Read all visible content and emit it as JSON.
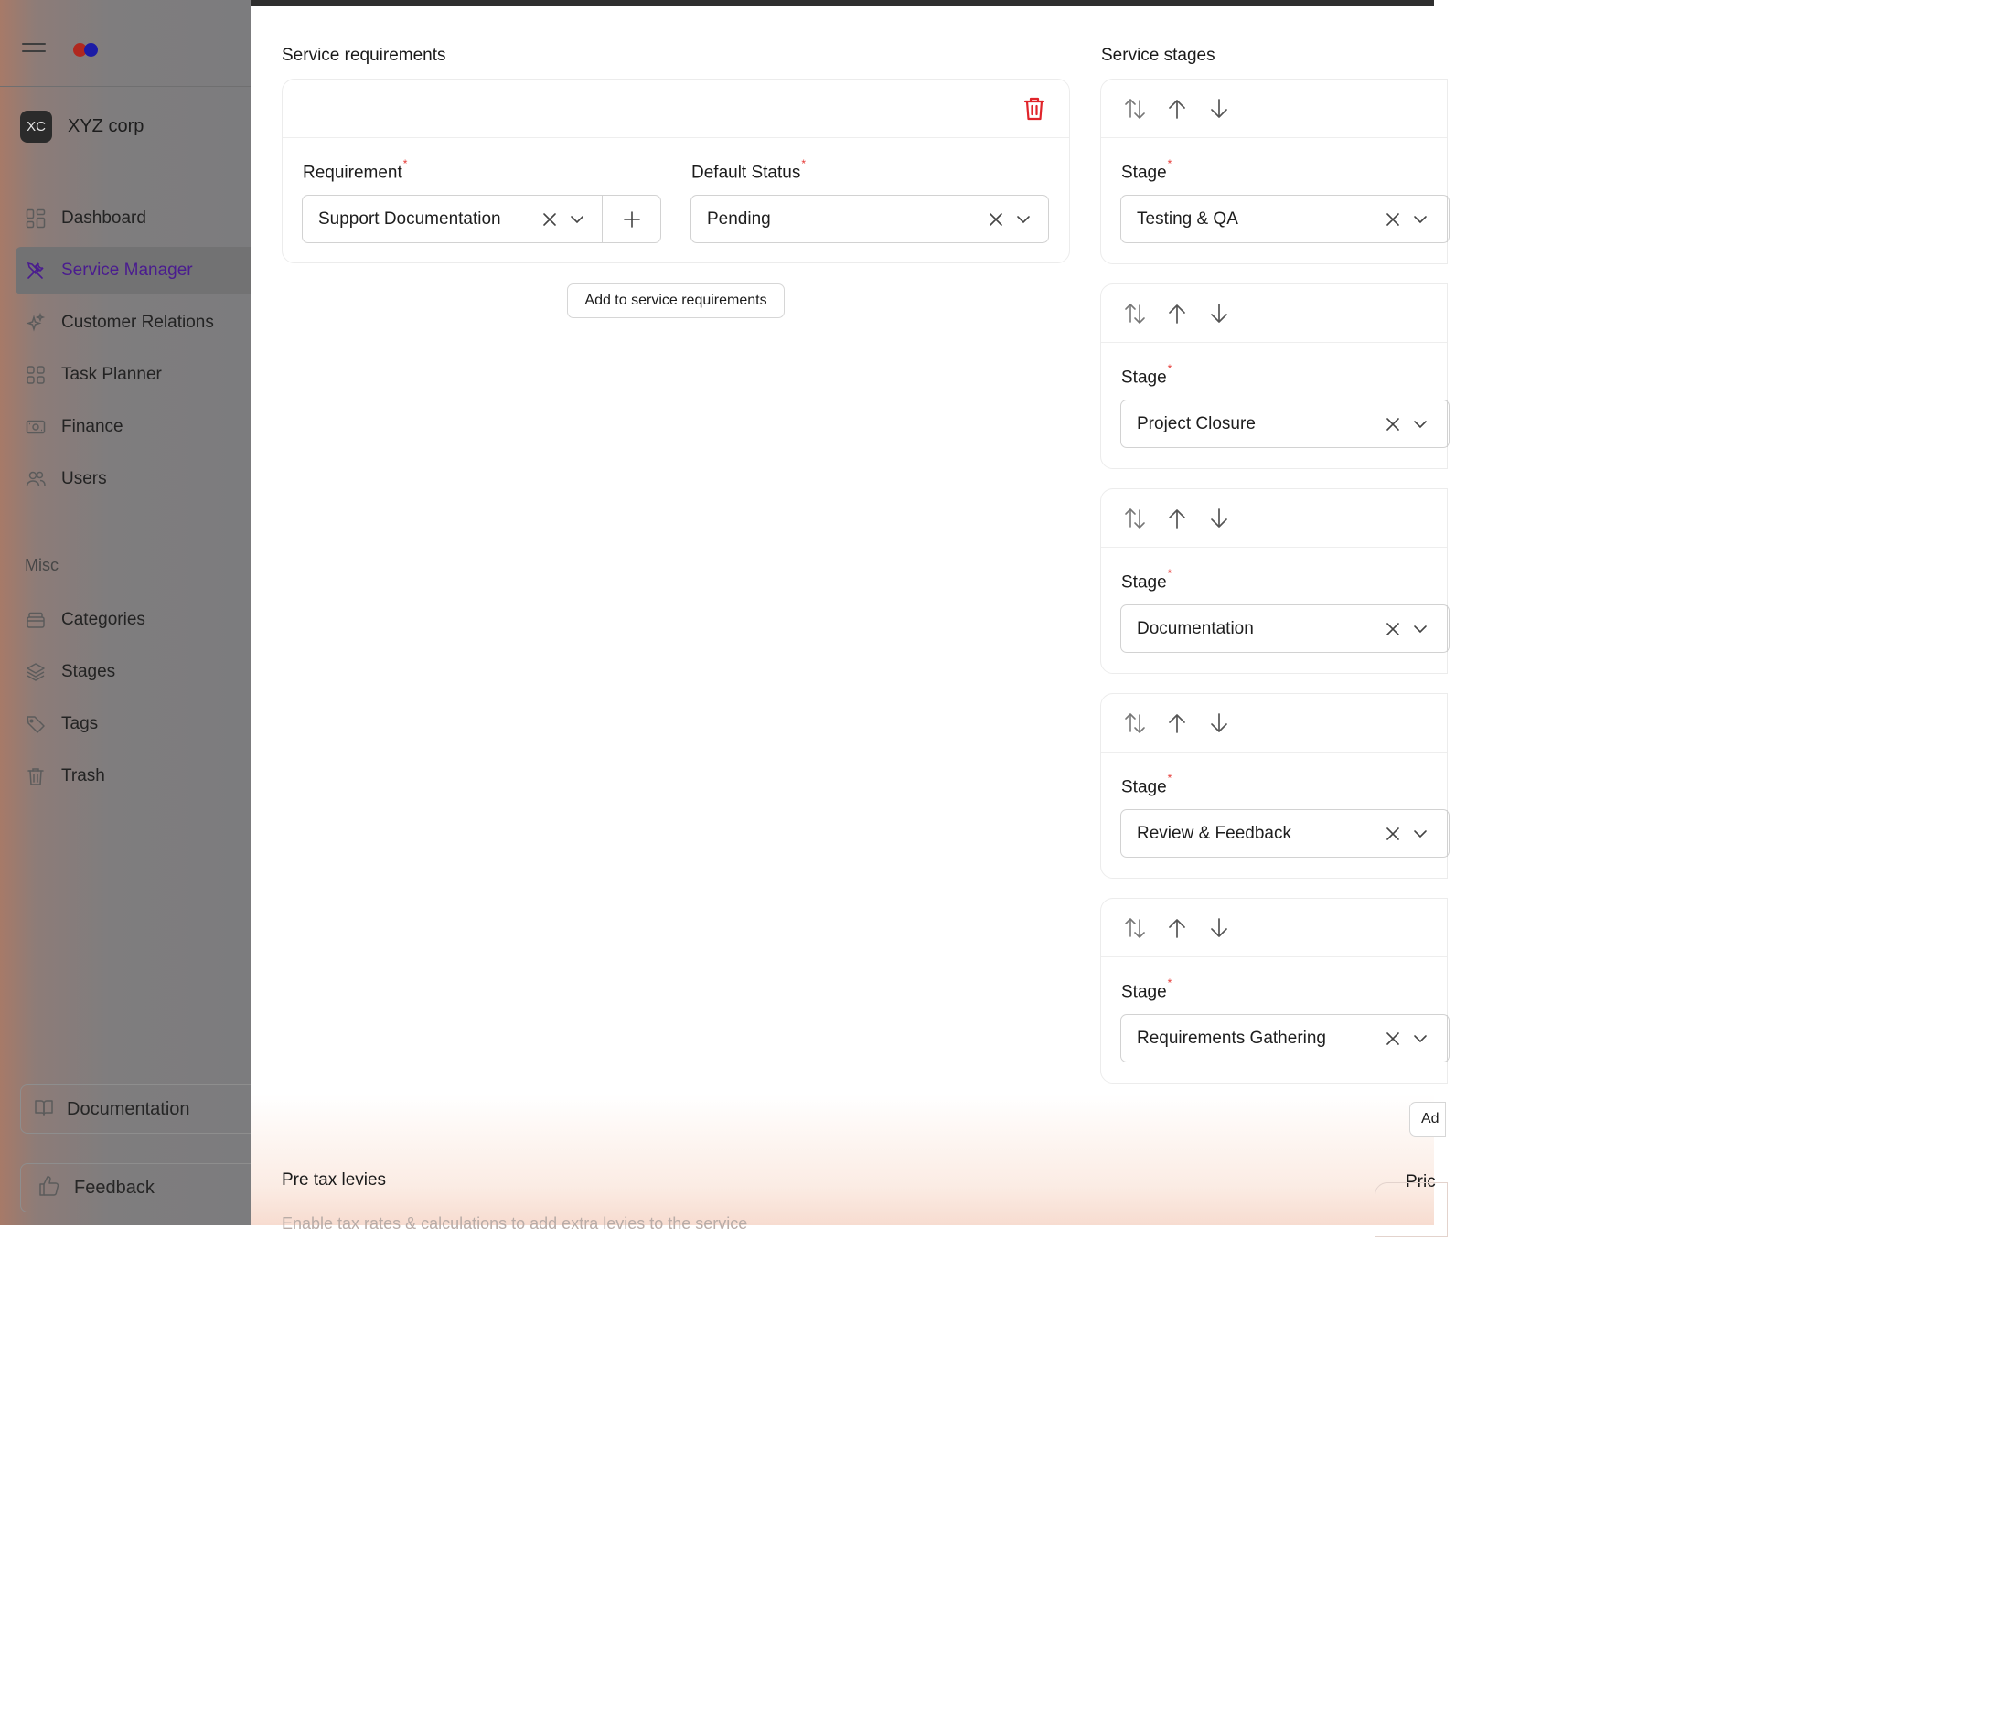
{
  "app": {
    "logo_dots": [
      "#c0392b",
      "#1f1fb0"
    ],
    "org_initials": "XC",
    "org_name": "XYZ corp"
  },
  "sidebar": {
    "items": [
      {
        "label": "Dashboard",
        "icon": "dashboard-icon"
      },
      {
        "label": "Service Manager",
        "icon": "tools-icon",
        "active": true
      },
      {
        "label": "Customer Relations",
        "icon": "sparkle-icon"
      },
      {
        "label": "Task Planner",
        "icon": "grid-icon"
      },
      {
        "label": "Finance",
        "icon": "banknote-icon"
      },
      {
        "label": "Users",
        "icon": "users-icon"
      }
    ],
    "misc_heading": "Misc",
    "misc_items": [
      {
        "label": "Categories",
        "icon": "archive-icon"
      },
      {
        "label": "Stages",
        "icon": "layers-icon"
      },
      {
        "label": "Tags",
        "icon": "tag-icon"
      },
      {
        "label": "Trash",
        "icon": "trash-icon"
      }
    ],
    "documentation_label": "Documentation",
    "feedback_label": "Feedback"
  },
  "requirements": {
    "section_title": "Service requirements",
    "requirement_label": "Requirement",
    "requirement_value": "Support Documentation",
    "status_label": "Default Status",
    "status_value": "Pending",
    "required_mark": "*",
    "add_button_label": "Add to service requirements"
  },
  "stages": {
    "section_title": "Service stages",
    "stage_label": "Stage",
    "items": [
      {
        "value": "Testing & QA"
      },
      {
        "value": "Project Closure"
      },
      {
        "value": "Documentation"
      },
      {
        "value": "Review & Feedback"
      },
      {
        "value": "Requirements Gathering"
      }
    ],
    "add_button_partial": "Ad"
  },
  "pretax": {
    "section_title": "Pre tax levies",
    "description_partial": "Enable tax rates & calculations to add extra levies to the service"
  },
  "pricing_partial": "Pric",
  "colors": {
    "accent": "#4a1c8f",
    "danger": "#e0242a",
    "required": "#e53935"
  }
}
